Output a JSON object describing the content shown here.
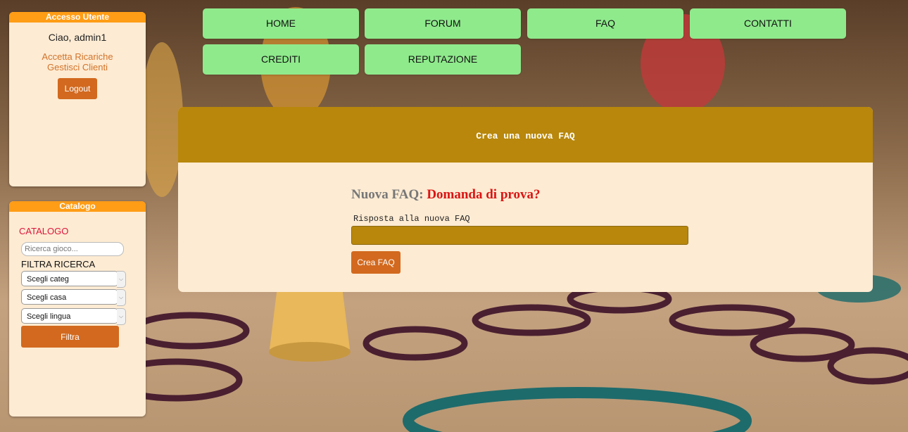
{
  "sidebar": {
    "user_panel": {
      "title": "Accesso Utente",
      "greeting": "Ciao, admin1",
      "links": [
        "Accetta Ricariche",
        "Gestisci Clienti"
      ],
      "logout_label": "Logout"
    },
    "catalog_panel": {
      "title": "Catalogo",
      "heading": "CATALOGO",
      "search_placeholder": "Ricerca gioco...",
      "filter_label": "FILTRA RICERCA",
      "selects": [
        {
          "selected": "Scegli categ"
        },
        {
          "selected": "Scegli casa"
        },
        {
          "selected": "Scegli lingua"
        }
      ],
      "filter_button": "Filtra"
    }
  },
  "nav": {
    "items": [
      "HOME",
      "FORUM",
      "FAQ",
      "CONTATTI",
      "CREDITI",
      "REPUTAZIONE"
    ]
  },
  "main": {
    "header": "Crea una nuova FAQ",
    "faq_prefix": "Nuova FAQ:",
    "faq_question": "Domanda di prova?",
    "answer_label": "Risposta alla nuova FAQ",
    "answer_value": "",
    "submit_label": "Crea FAQ"
  },
  "colors": {
    "panel_bg": "#fdebd3",
    "panel_header": "#ff9d16",
    "nav_button": "#8fea8c",
    "card_header": "#b8870b",
    "action_button": "#d2691e",
    "link": "#d2732a",
    "question": "#dc1414"
  }
}
